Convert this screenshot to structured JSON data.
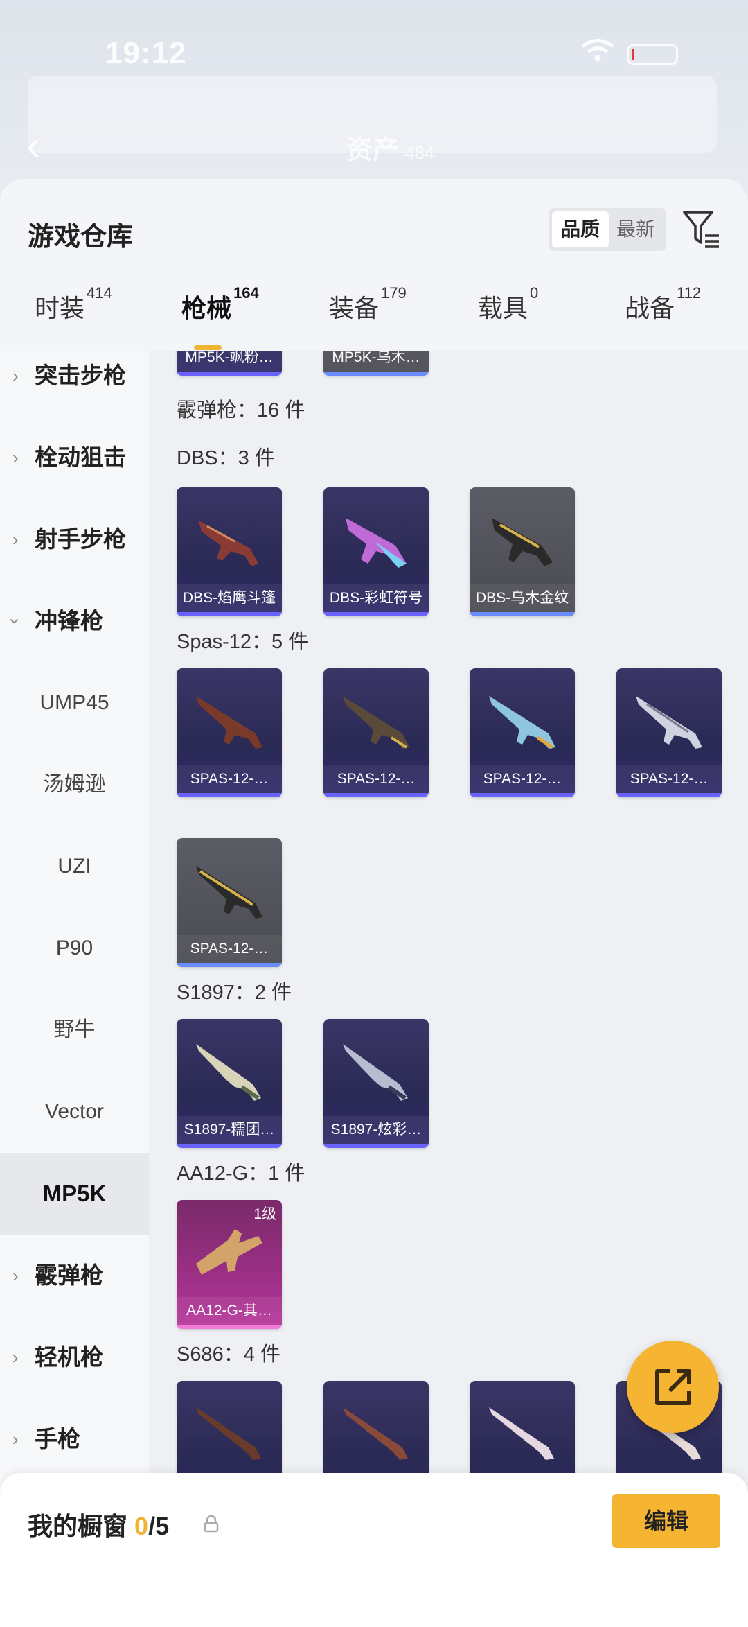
{
  "status_bar": {
    "time": "19:12"
  },
  "header_blur": {
    "title": "资产",
    "title_suffix": "484"
  },
  "sheet": {
    "title": "游戏仓库",
    "sort": {
      "quality": "品质",
      "latest": "最新"
    }
  },
  "tabs": [
    {
      "label": "时装",
      "count": "414"
    },
    {
      "label": "枪械",
      "count": "164"
    },
    {
      "label": "装备",
      "count": "179"
    },
    {
      "label": "载具",
      "count": "0"
    },
    {
      "label": "战备",
      "count": "112"
    }
  ],
  "sidebar": {
    "items": [
      {
        "label": "突击步枪",
        "expandable": true
      },
      {
        "label": "栓动狙击",
        "expandable": true
      },
      {
        "label": "射手步枪",
        "expandable": true
      },
      {
        "label": "冲锋枪",
        "expanded": true
      },
      {
        "label": "UMP45"
      },
      {
        "label": "汤姆逊"
      },
      {
        "label": "UZI"
      },
      {
        "label": "P90"
      },
      {
        "label": "野牛"
      },
      {
        "label": "Vector"
      },
      {
        "label": "MP5K",
        "selected": true
      },
      {
        "label": "霰弹枪",
        "expandable": true
      },
      {
        "label": "轻机枪",
        "expandable": true
      },
      {
        "label": "手枪",
        "expandable": true
      }
    ]
  },
  "content": {
    "top_cards": [
      {
        "name": "MP5K-飒粉…"
      },
      {
        "name": "MP5K-乌木…"
      }
    ],
    "category_total": "霰弹枪：16 件",
    "sections": [
      {
        "label": "DBS：3 件",
        "cards": [
          {
            "name": "DBS-焰鹰斗篷",
            "style": "purple"
          },
          {
            "name": "DBS-彩虹符号",
            "style": "purple"
          },
          {
            "name": "DBS-乌木金纹",
            "style": "gray"
          }
        ]
      },
      {
        "label": "Spas-12：5 件",
        "cards": [
          {
            "name": "SPAS-12-…",
            "style": "purple"
          },
          {
            "name": "SPAS-12-…",
            "style": "purple"
          },
          {
            "name": "SPAS-12-…",
            "style": "purple"
          },
          {
            "name": "SPAS-12-…",
            "style": "purple"
          },
          {
            "name": "SPAS-12-…",
            "style": "gray"
          }
        ]
      },
      {
        "label": "S1897：2 件",
        "cards": [
          {
            "name": "S1897-糯团…",
            "style": "purple"
          },
          {
            "name": "S1897-炫彩…",
            "style": "purple"
          }
        ]
      },
      {
        "label": "AA12-G：1 件",
        "cards": [
          {
            "name": "AA12-G-其…",
            "style": "pink",
            "level": "1级"
          }
        ]
      },
      {
        "label": "S686：4 件",
        "cards": [
          {
            "name": "",
            "style": "purple"
          },
          {
            "name": "",
            "style": "purple"
          },
          {
            "name": "",
            "style": "purple"
          },
          {
            "name": "",
            "style": "purple"
          }
        ]
      }
    ]
  },
  "bottom_bar": {
    "label": "我的橱窗",
    "count": "0",
    "total": "/5",
    "edit": "编辑"
  },
  "icons": {
    "back": "back-arrow-icon",
    "filter": "filter-icon",
    "share": "share-external-icon",
    "lock": "lock-icon"
  },
  "colors": {
    "accent": "#f5b431",
    "card_purple": "#2a2a55",
    "card_pink": "#9c2f86"
  }
}
